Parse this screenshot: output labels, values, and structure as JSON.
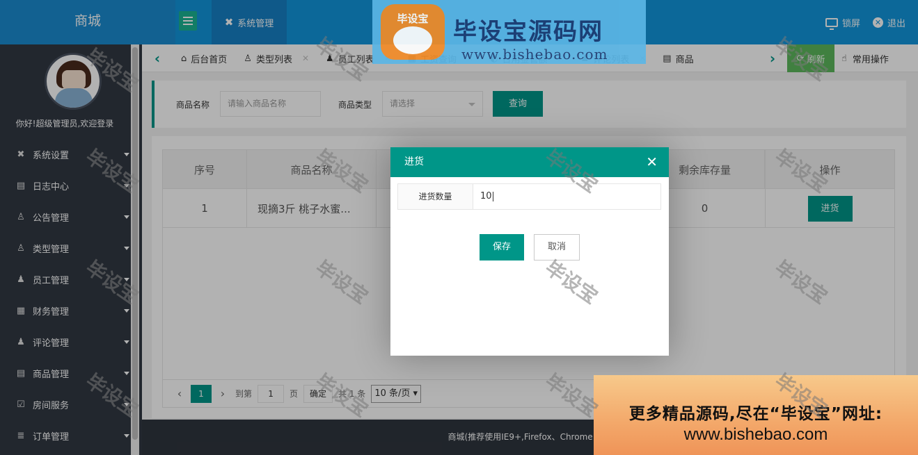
{
  "header": {
    "app_title": "商城",
    "module_tab": "系统管理",
    "lock_label": "锁屏",
    "logout_label": "退出"
  },
  "banner": {
    "logo_text": "毕设宝",
    "title": "毕设宝源码网",
    "url": "www.bishebao.com"
  },
  "sidebar": {
    "welcome": "你好!超级管理员,欢迎登录",
    "items": [
      {
        "label": "系统设置",
        "icon": "wrench-icon",
        "glyph": "✖"
      },
      {
        "label": "日志中心",
        "icon": "log-icon",
        "glyph": "▤"
      },
      {
        "label": "公告管理",
        "icon": "user-icon",
        "glyph": "♙"
      },
      {
        "label": "类型管理",
        "icon": "user-group-icon",
        "glyph": "♙"
      },
      {
        "label": "员工管理",
        "icon": "staff-icon",
        "glyph": "♟"
      },
      {
        "label": "财务管理",
        "icon": "grid-icon",
        "glyph": "▦"
      },
      {
        "label": "评论管理",
        "icon": "comment-user-icon",
        "glyph": "♟"
      },
      {
        "label": "商品管理",
        "icon": "document-icon",
        "glyph": "▤"
      },
      {
        "label": "房间服务",
        "icon": "clipboard-icon",
        "glyph": "☑"
      },
      {
        "label": "订单管理",
        "icon": "database-icon",
        "glyph": "≣"
      }
    ]
  },
  "tabs": {
    "items": [
      {
        "label": "后台首页",
        "icon": "home-icon",
        "glyph": "⌂",
        "closable": false
      },
      {
        "label": "类型列表",
        "icon": "user-icon",
        "glyph": "♙",
        "closable": true
      },
      {
        "label": "员工列表",
        "icon": "staff-icon",
        "glyph": "♟",
        "closable": true
      },
      {
        "label": "工资查询",
        "icon": "grid-icon",
        "glyph": "▦",
        "closable": true
      },
      {
        "label": "日用金管额",
        "icon": "money-icon",
        "glyph": "◐",
        "closable": true
      },
      {
        "label": "评论列表",
        "icon": "comment-user-icon",
        "glyph": "♟",
        "closable": true
      },
      {
        "label": "商品",
        "icon": "document-icon",
        "glyph": "▤",
        "closable": false
      }
    ],
    "refresh_label": "刷新",
    "common_ops_label": "常用操作"
  },
  "search": {
    "name_label": "商品名称",
    "name_placeholder": "请输入商品名称",
    "type_label": "商品类型",
    "type_placeholder": "请选择",
    "query_button": "查询"
  },
  "table": {
    "headers": [
      "序号",
      "商品名称",
      "剩余库存量",
      "操作"
    ],
    "rows": [
      {
        "index": "1",
        "name": "现摘3斤 桃子水蜜...",
        "stock": "0",
        "action": "进货"
      }
    ]
  },
  "pager": {
    "current_page": "1",
    "goto_label": "到第",
    "page_input": "1",
    "page_unit": "页",
    "confirm": "确定",
    "total": "共 1 条",
    "page_size": "10 条/页"
  },
  "footer": {
    "text": "商城(推荐使用IE9+,Firefox、Chrome 浏览"
  },
  "ad": {
    "line1": "更多精品源码,尽在“毕设宝”网址:",
    "line2": "www.bishebao.com"
  },
  "modal": {
    "title": "进货",
    "field_label": "进货数量",
    "field_value": "10",
    "save_button": "保存",
    "cancel_button": "取消"
  },
  "watermark": "毕设宝",
  "colors": {
    "primary": "#009688",
    "header": "#1296db",
    "sidebar": "#313843",
    "refresh": "#5cb85c"
  }
}
